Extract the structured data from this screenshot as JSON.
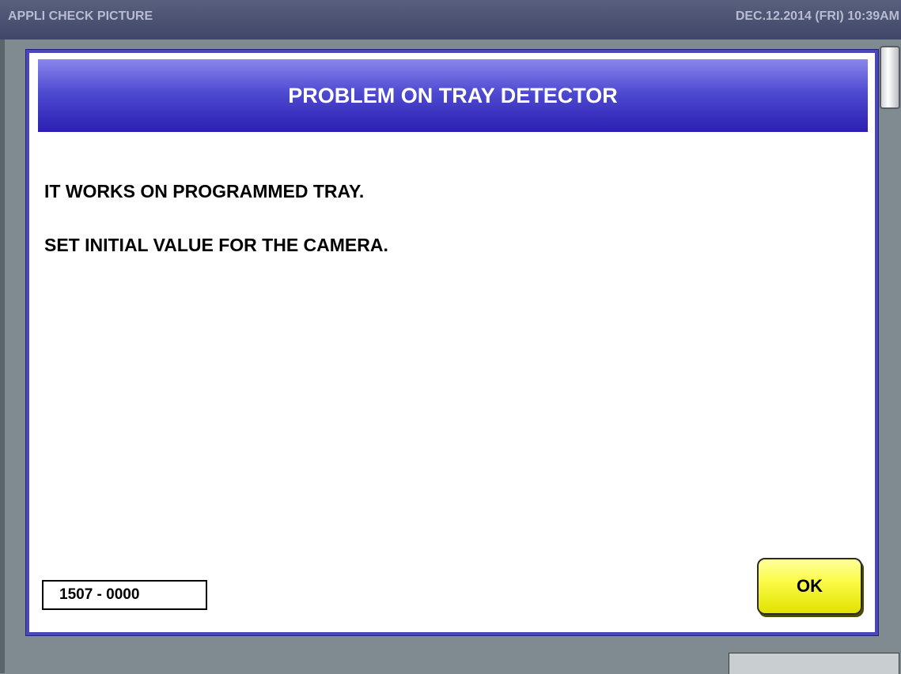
{
  "titlebar": {
    "app_title": "APPLI CHECK PICTURE",
    "datetime": "DEC.12.2014 (FRI)  10:39AM"
  },
  "dialog": {
    "title": "PROBLEM ON TRAY DETECTOR",
    "messages": [
      "IT WORKS ON PROGRAMMED TRAY.",
      "SET INITIAL VALUE FOR THE CAMERA."
    ],
    "error_code": "1507 - 0000",
    "ok_label": "OK"
  },
  "colors": {
    "header_gradient_top": "#8a86ec",
    "header_gradient_bottom": "#2b1fb0",
    "ok_button": "#fbfb49",
    "background": "#7f8b90"
  }
}
